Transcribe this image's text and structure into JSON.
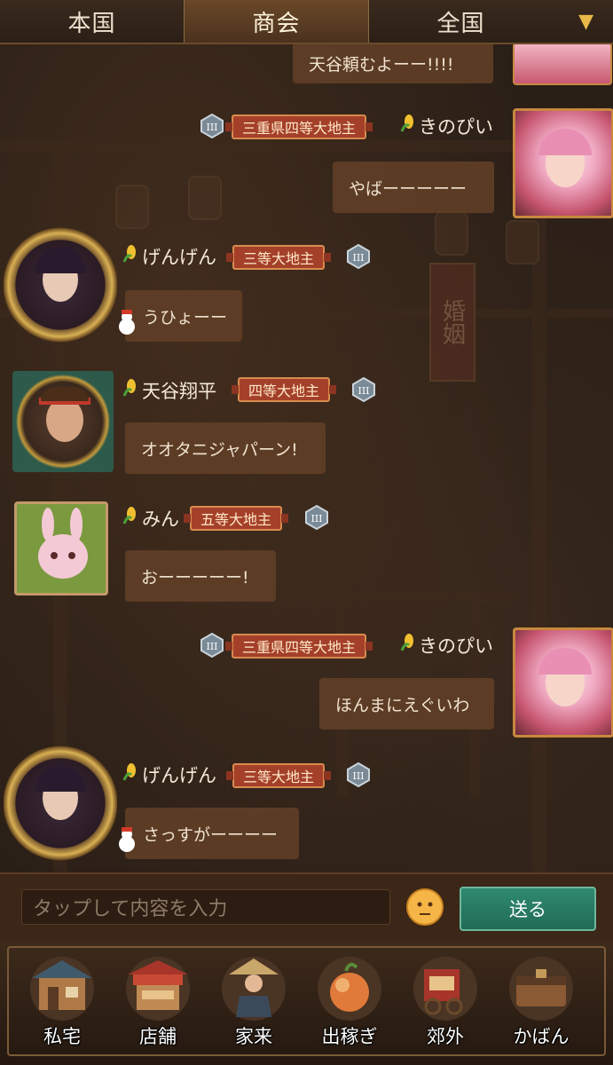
{
  "tabs": [
    {
      "label": "本国",
      "active": false
    },
    {
      "label": "商会",
      "active": true
    },
    {
      "label": "全国",
      "active": false
    }
  ],
  "dropdown_icon": "chevron-down-icon",
  "scene": {
    "sign_text": "婚姻"
  },
  "messages": [
    {
      "side": "right",
      "partial": true,
      "text": "天谷頼むよーー!!!!"
    },
    {
      "side": "right",
      "name": "きのぴい",
      "title": "三重県四等大地主",
      "rank": "III",
      "text": "やばーーーーー"
    },
    {
      "side": "left",
      "name": "げんげん",
      "title": "三等大地主",
      "rank": "III",
      "text": "うひょーー"
    },
    {
      "side": "left",
      "name": "天谷翔平",
      "title": "四等大地主",
      "rank": "III",
      "text": "オオタニジャパーン!"
    },
    {
      "side": "left",
      "name": "みん",
      "title": "五等大地主",
      "rank": "III",
      "text": "おーーーーー!"
    },
    {
      "side": "right",
      "name": "きのぴい",
      "title": "三重県四等大地主",
      "rank": "III",
      "text": "ほんまにえぐいわ"
    },
    {
      "side": "left",
      "name": "げんげん",
      "title": "三等大地主",
      "rank": "III",
      "text": "さっすがーーーー"
    }
  ],
  "input": {
    "placeholder": "タップして内容を入力",
    "send_label": "送る"
  },
  "nav": [
    {
      "label": "私宅",
      "icon": "residence-icon"
    },
    {
      "label": "店舗",
      "icon": "shop-icon"
    },
    {
      "label": "家来",
      "icon": "retainer-icon"
    },
    {
      "label": "出稼ぎ",
      "icon": "work-icon"
    },
    {
      "label": "郊外",
      "icon": "suburb-icon"
    },
    {
      "label": "かばん",
      "icon": "bag-icon"
    }
  ],
  "colors": {
    "title_badge": "#a4402a",
    "send_button": "#2f8a6e",
    "bubble": "#5f3e26",
    "accent_gold": "#e9b84a"
  }
}
